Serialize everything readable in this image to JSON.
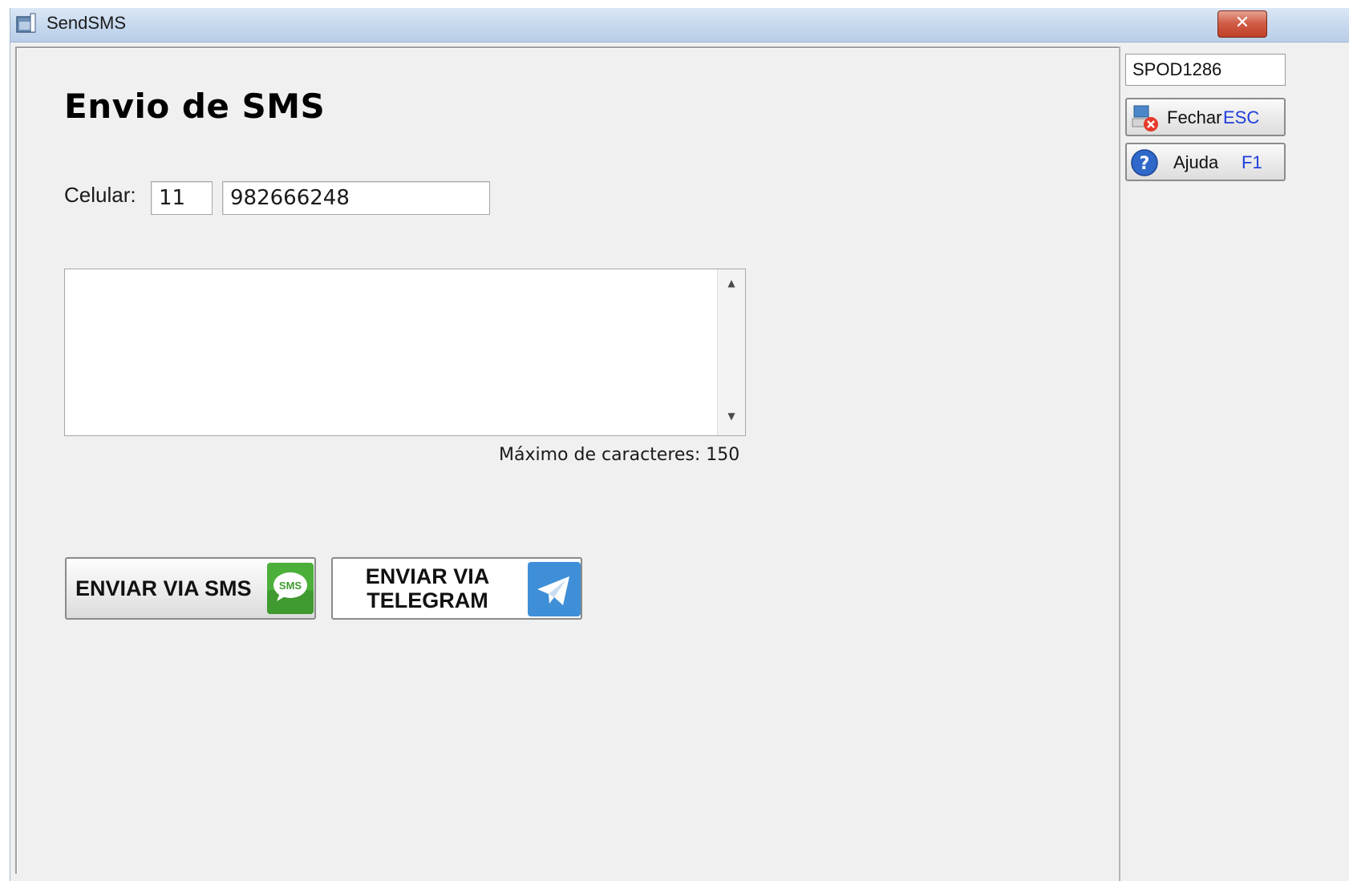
{
  "window": {
    "title": "SendSMS",
    "close_label": "✕"
  },
  "form": {
    "heading": "Envio de SMS",
    "celular_label": "Celular:",
    "ddd_value": "11",
    "phone_value": "982666248",
    "message_value": "",
    "max_chars_text": "Máximo de caracteres: 150"
  },
  "buttons": {
    "sms_label": "ENVIAR VIA SMS",
    "sms_icon_text": "SMS",
    "telegram_label_line1": "ENVIAR VIA",
    "telegram_label_line2": "TELEGRAM"
  },
  "side": {
    "code_value": "SPOD1286",
    "fechar_label": "Fechar",
    "fechar_key": "ESC",
    "ajuda_label": "Ajuda",
    "ajuda_key": "F1"
  },
  "colors": {
    "titlebar": "#c6d8ee",
    "close_button": "#c94a33",
    "sms_green": "#4caf3a",
    "telegram_blue": "#3f8fd8",
    "shortcut_blue": "#1e3ddc"
  },
  "icons": {
    "app": "window-app-icon",
    "close": "close-icon",
    "sms": "sms-bubble-icon",
    "telegram": "paper-plane-icon",
    "fechar": "close-computer-icon",
    "ajuda": "help-icon"
  }
}
